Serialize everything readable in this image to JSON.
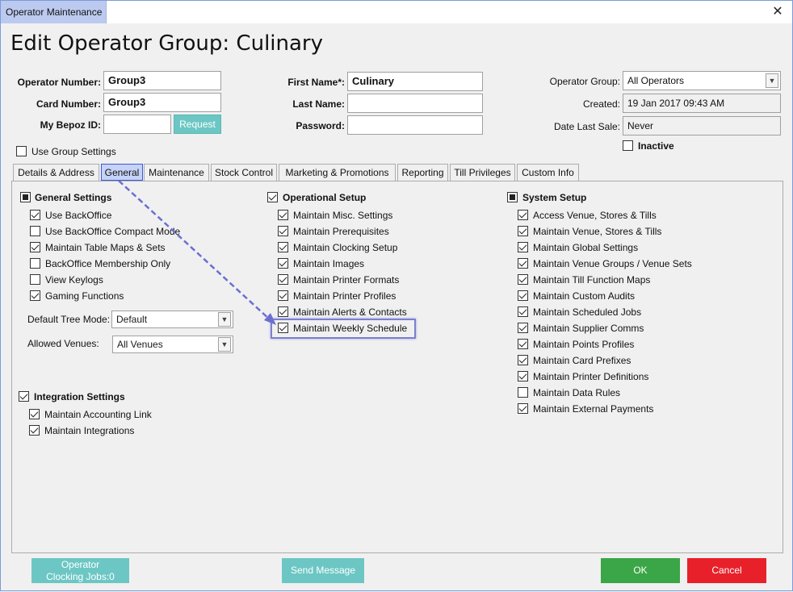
{
  "window": {
    "title": "Operator Maintenance",
    "close": "✕"
  },
  "heading": "Edit Operator Group: Culinary",
  "form": {
    "operator_number": {
      "label": "Operator Number:",
      "value": "Group3"
    },
    "card_number": {
      "label": "Card Number:",
      "value": "Group3"
    },
    "bepoz_id": {
      "label": "My Bepoz ID:",
      "value": "",
      "button": "Request"
    },
    "first_name": {
      "label": "First Name*:",
      "value": "Culinary"
    },
    "last_name": {
      "label": "Last Name:",
      "value": ""
    },
    "password": {
      "label": "Password:",
      "value": ""
    },
    "operator_group": {
      "label": "Operator Group:",
      "value": "All Operators"
    },
    "created": {
      "label": "Created:",
      "value": "19 Jan 2017 09:43 AM"
    },
    "date_last_sale": {
      "label": "Date Last Sale:",
      "value": "Never"
    },
    "inactive": {
      "label": "Inactive",
      "checked": false
    },
    "use_group_settings": {
      "label": "Use Group Settings",
      "checked": false
    }
  },
  "tabs": [
    {
      "label": "Details & Address"
    },
    {
      "label": "General",
      "active": true
    },
    {
      "label": "Maintenance"
    },
    {
      "label": "Stock Control"
    },
    {
      "label": "Marketing & Promotions"
    },
    {
      "label": "Reporting"
    },
    {
      "label": "Till Privileges"
    },
    {
      "label": "Custom Info"
    }
  ],
  "general_settings": {
    "title": "General Settings",
    "items": [
      {
        "label": "Use BackOffice",
        "checked": true
      },
      {
        "label": "Use BackOffice Compact Mode",
        "checked": false
      },
      {
        "label": "Maintain Table Maps & Sets",
        "checked": true
      },
      {
        "label": "BackOffice Membership Only",
        "checked": false
      },
      {
        "label": "View Keylogs",
        "checked": false
      },
      {
        "label": "Gaming Functions",
        "checked": true
      }
    ],
    "default_tree_mode": {
      "label": "Default Tree Mode:",
      "value": "Default"
    },
    "allowed_venues": {
      "label": "Allowed Venues:",
      "value": "All Venues"
    }
  },
  "integration_settings": {
    "title": "Integration Settings",
    "items": [
      {
        "label": "Maintain Accounting Link",
        "checked": true
      },
      {
        "label": "Maintain Integrations",
        "checked": true
      }
    ]
  },
  "operational_setup": {
    "title": "Operational Setup",
    "items": [
      {
        "label": "Maintain Misc. Settings",
        "checked": true
      },
      {
        "label": "Maintain Prerequisites",
        "checked": true
      },
      {
        "label": "Maintain Clocking Setup",
        "checked": true
      },
      {
        "label": "Maintain Images",
        "checked": true
      },
      {
        "label": "Maintain Printer Formats",
        "checked": true
      },
      {
        "label": "Maintain Printer Profiles",
        "checked": true
      },
      {
        "label": "Maintain Alerts & Contacts",
        "checked": true
      },
      {
        "label": "Maintain Weekly Schedule",
        "checked": true
      }
    ]
  },
  "system_setup": {
    "title": "System Setup",
    "items": [
      {
        "label": "Access Venue, Stores & Tills",
        "checked": true
      },
      {
        "label": "Maintain Venue, Stores & Tills",
        "checked": true
      },
      {
        "label": "Maintain Global Settings",
        "checked": true
      },
      {
        "label": "Maintain Venue Groups / Venue Sets",
        "checked": true
      },
      {
        "label": "Maintain Till Function Maps",
        "checked": true
      },
      {
        "label": "Maintain Custom Audits",
        "checked": true
      },
      {
        "label": "Maintain Scheduled Jobs",
        "checked": true
      },
      {
        "label": "Maintain Supplier Comms",
        "checked": true
      },
      {
        "label": "Maintain Points Profiles",
        "checked": true
      },
      {
        "label": "Maintain Card Prefixes",
        "checked": true
      },
      {
        "label": "Maintain Printer Definitions",
        "checked": true
      },
      {
        "label": "Maintain Data Rules",
        "checked": false
      },
      {
        "label": "Maintain External Payments",
        "checked": true
      }
    ]
  },
  "footer": {
    "clocking_line1": "Operator",
    "clocking_line2": "Clocking Jobs:0",
    "send_message": "Send Message",
    "ok": "OK",
    "cancel": "Cancel"
  },
  "colors": {
    "teal": "#6cc7c4",
    "ok_green": "#3aa647",
    "cancel_red": "#e8202a",
    "annotation": "#6b6fd0"
  },
  "icons": {
    "dropdown": "chevron-down-icon",
    "close": "close-icon"
  }
}
